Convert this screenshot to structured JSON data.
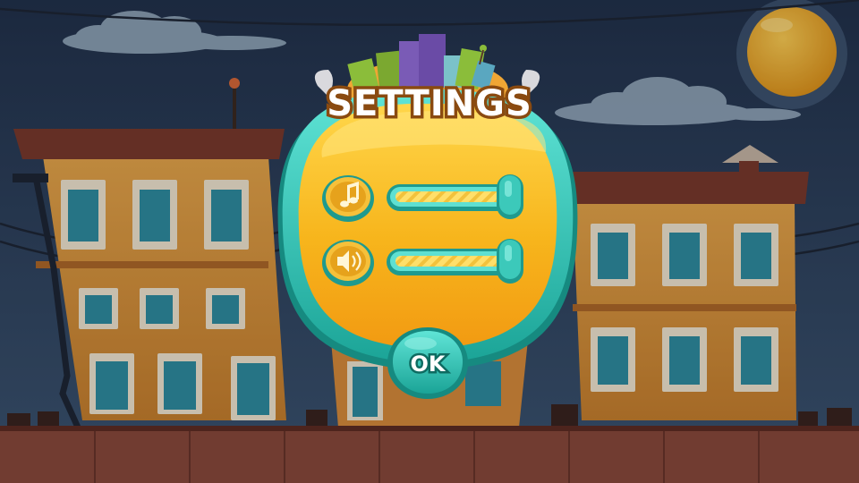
{
  "dialog": {
    "title": "SETTINGS",
    "ok_label": "OK"
  },
  "settings": [
    {
      "name": "music",
      "icon": "music-note-icon",
      "level": 1.0
    },
    {
      "name": "sound",
      "icon": "speaker-icon",
      "level": 1.0
    }
  ],
  "colors": {
    "sky": "#2b3b57",
    "panel": "#f7b81e",
    "frame": "#27c2b3",
    "building": "#e3a04a",
    "roof": "#7a3a2e"
  }
}
